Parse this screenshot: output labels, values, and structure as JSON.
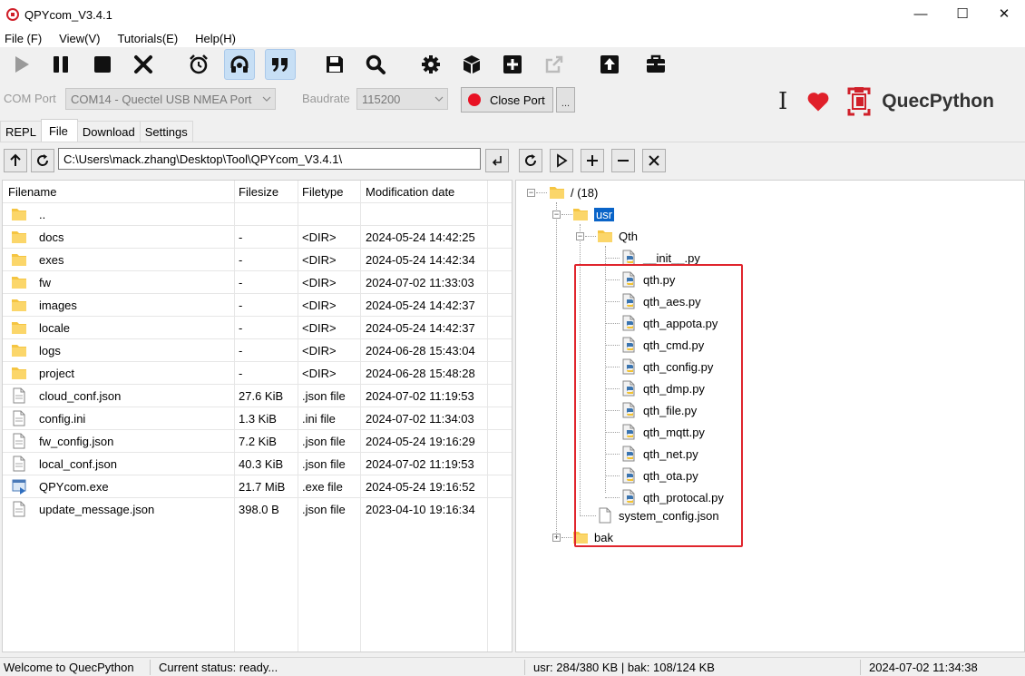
{
  "window": {
    "title": "QPYcom_V3.4.1",
    "minimize": "—",
    "maximize": "☐",
    "close": "✕"
  },
  "menu": [
    "File (F)",
    "View(V)",
    "Tutorials(E)",
    "Help(H)"
  ],
  "toolbar": {
    "icons": [
      "play-icon",
      "pause-icon",
      "stop-icon",
      "close-x-icon",
      "alarm-clock-icon",
      "headset-icon",
      "quote-icon",
      "save-icon",
      "search-icon",
      "gear-icon",
      "cube-icon",
      "plus-square-icon",
      "export-icon",
      "upload-icon",
      "toolbox-icon"
    ]
  },
  "port": {
    "com_label": "COM Port",
    "com_value": "COM14 - Quectel USB NMEA Port",
    "baud_label": "Baudrate",
    "baud_value": "115200",
    "close_port": "Close Port",
    "more": "...",
    "brand_cursor": "I",
    "brand_name": "QuecPython"
  },
  "tabs": [
    "REPL",
    "File",
    "Download",
    "Settings"
  ],
  "selected_tab": "File",
  "left": {
    "path": "C:\\Users\\mack.zhang\\Desktop\\Tool\\QPYcom_V3.4.1\\",
    "headers": [
      "Filename",
      "Filesize",
      "Filetype",
      "Modification date"
    ],
    "rows": [
      {
        "name": "..",
        "size": "",
        "type": "",
        "date": "",
        "kind": "folder"
      },
      {
        "name": "docs",
        "size": "-",
        "type": "<DIR>",
        "date": "2024-05-24 14:42:25",
        "kind": "folder"
      },
      {
        "name": "exes",
        "size": "-",
        "type": "<DIR>",
        "date": "2024-05-24 14:42:34",
        "kind": "folder"
      },
      {
        "name": "fw",
        "size": "-",
        "type": "<DIR>",
        "date": "2024-07-02 11:33:03",
        "kind": "folder"
      },
      {
        "name": "images",
        "size": "-",
        "type": "<DIR>",
        "date": "2024-05-24 14:42:37",
        "kind": "folder"
      },
      {
        "name": "locale",
        "size": "-",
        "type": "<DIR>",
        "date": "2024-05-24 14:42:37",
        "kind": "folder"
      },
      {
        "name": "logs",
        "size": "-",
        "type": "<DIR>",
        "date": "2024-06-28 15:43:04",
        "kind": "folder"
      },
      {
        "name": "project",
        "size": "-",
        "type": "<DIR>",
        "date": "2024-06-28 15:48:28",
        "kind": "folder"
      },
      {
        "name": "cloud_conf.json",
        "size": "27.6 KiB",
        "type": ".json file",
        "date": "2024-07-02 11:19:53",
        "kind": "file"
      },
      {
        "name": "config.ini",
        "size": "1.3 KiB",
        "type": ".ini file",
        "date": "2024-07-02 11:34:03",
        "kind": "file"
      },
      {
        "name": "fw_config.json",
        "size": "7.2 KiB",
        "type": ".json file",
        "date": "2024-05-24 19:16:29",
        "kind": "file"
      },
      {
        "name": "local_conf.json",
        "size": "40.3 KiB",
        "type": ".json file",
        "date": "2024-07-02 11:19:53",
        "kind": "file"
      },
      {
        "name": "QPYcom.exe",
        "size": "21.7 MiB",
        "type": ".exe file",
        "date": "2024-05-24 19:16:52",
        "kind": "exe"
      },
      {
        "name": "update_message.json",
        "size": "398.0 B",
        "type": ".json file",
        "date": "2023-04-10 19:16:34",
        "kind": "file"
      }
    ]
  },
  "tree": {
    "root": "/ (18)",
    "usr": "usr",
    "qth": "Qth",
    "qth_files": [
      "__init__.py",
      "qth.py",
      "qth_aes.py",
      "qth_appota.py",
      "qth_cmd.py",
      "qth_config.py",
      "qth_dmp.py",
      "qth_file.py",
      "qth_mqtt.py",
      "qth_net.py",
      "qth_ota.py",
      "qth_protocal.py"
    ],
    "system_config": "system_config.json",
    "bak": "bak",
    "expanded_mark": "−",
    "collapsed_mark": "+"
  },
  "status": {
    "welcome": "Welcome to QuecPython",
    "current": "Current status: ready...",
    "memory": "usr: 284/380 KB | bak: 108/124 KB",
    "datetime": "2024-07-02 11:34:38"
  }
}
